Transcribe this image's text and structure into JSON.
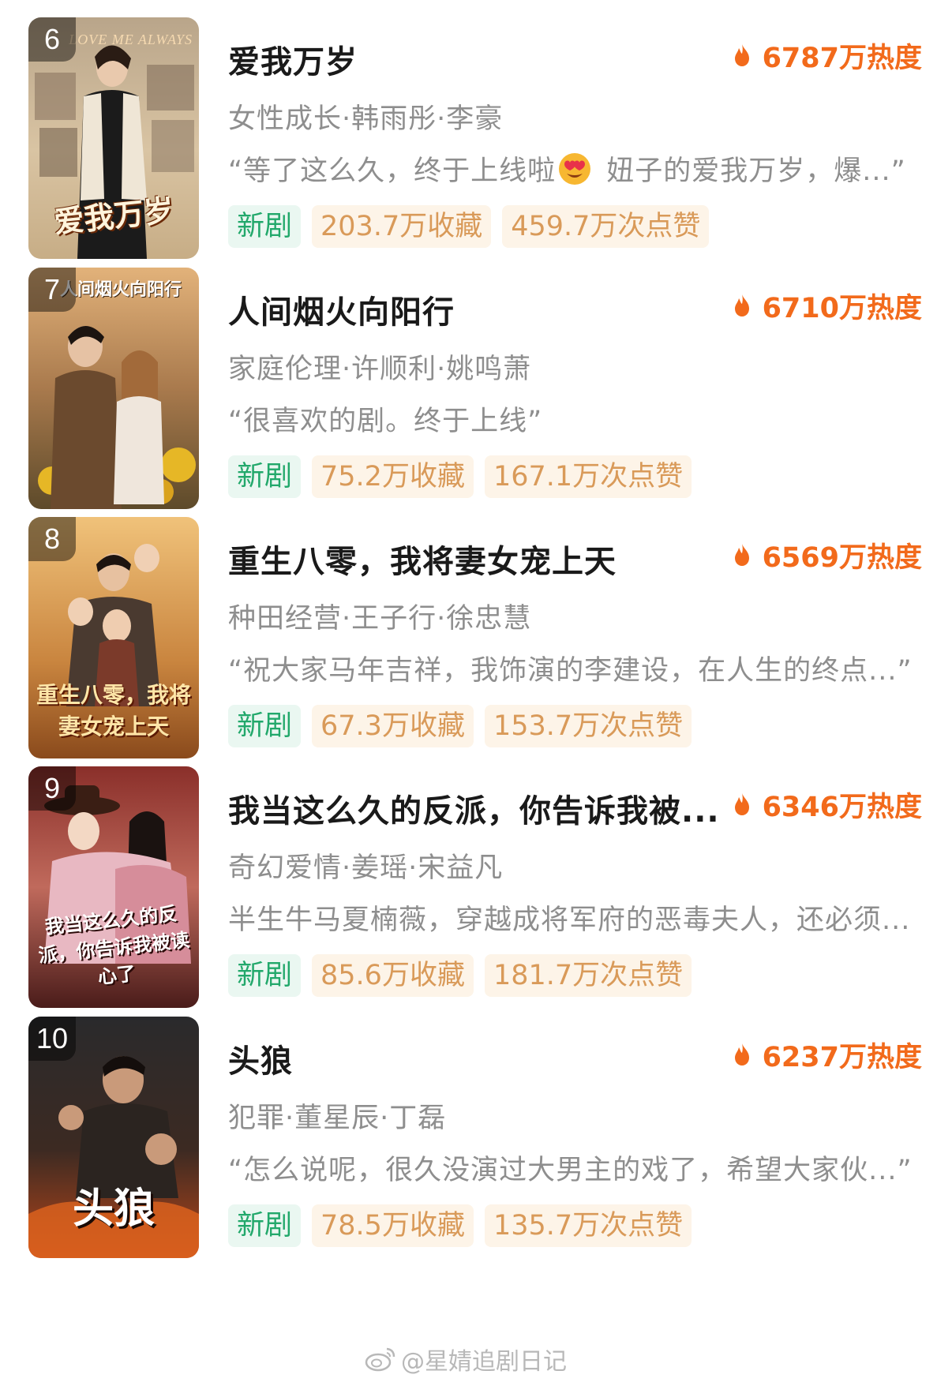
{
  "accent_color": "#f26a1b",
  "tag_new_color": "#22a86b",
  "tag_stat_color": "#d99a59",
  "items": [
    {
      "rank": "6",
      "title": "爱我万岁",
      "heat": "6787万热度",
      "meta": "女性成长·韩雨彤·李豪",
      "quote_before": "“等了这么久，终于上线啦",
      "quote_emoji": "heart-eyes-emoji",
      "quote_after": " 妞子的爱我万岁，爆...”",
      "tag_new": "新剧",
      "favorites": "203.7万收藏",
      "likes": "459.7万次点赞",
      "poster_title": "爱我万岁",
      "poster_sub": "LOVE ME ALWAYS"
    },
    {
      "rank": "7",
      "title": "人间烟火向阳行",
      "heat": "6710万热度",
      "meta": "家庭伦理·许顺利·姚鸣萧",
      "quote": "“很喜欢的剧。终于上线”",
      "tag_new": "新剧",
      "favorites": "75.2万收藏",
      "likes": "167.1万次点赞",
      "poster_title": "人间烟火向阳行"
    },
    {
      "rank": "8",
      "title": "重生八零，我将妻女宠上天",
      "heat": "6569万热度",
      "meta": "种田经营·王子行·徐忠慧",
      "quote": "“祝大家马年吉祥，我饰演的李建设，在人生的终点...”",
      "tag_new": "新剧",
      "favorites": "67.3万收藏",
      "likes": "153.7万次点赞",
      "poster_title": "重生八零，我将妻女宠上天"
    },
    {
      "rank": "9",
      "title": "我当这么久的反派，你告诉我被...",
      "heat": "6346万热度",
      "meta": "奇幻爱情·姜瑶·宋益凡",
      "quote": "半生牛马夏楠薇，穿越成将军府的恶毒夫人，还必须...",
      "tag_new": "新剧",
      "favorites": "85.6万收藏",
      "likes": "181.7万次点赞",
      "poster_title": "我当这么久的反派，你告诉我被读心了"
    },
    {
      "rank": "10",
      "title": "头狼",
      "heat": "6237万热度",
      "meta": "犯罪·董星辰·丁磊",
      "quote": "“怎么说呢，很久没演过大男主的戏了，希望大家伙...”",
      "tag_new": "新剧",
      "favorites": "78.5万收藏",
      "likes": "135.7万次点赞",
      "poster_title": "头狼"
    }
  ],
  "watermark": "@星婧追剧日记"
}
